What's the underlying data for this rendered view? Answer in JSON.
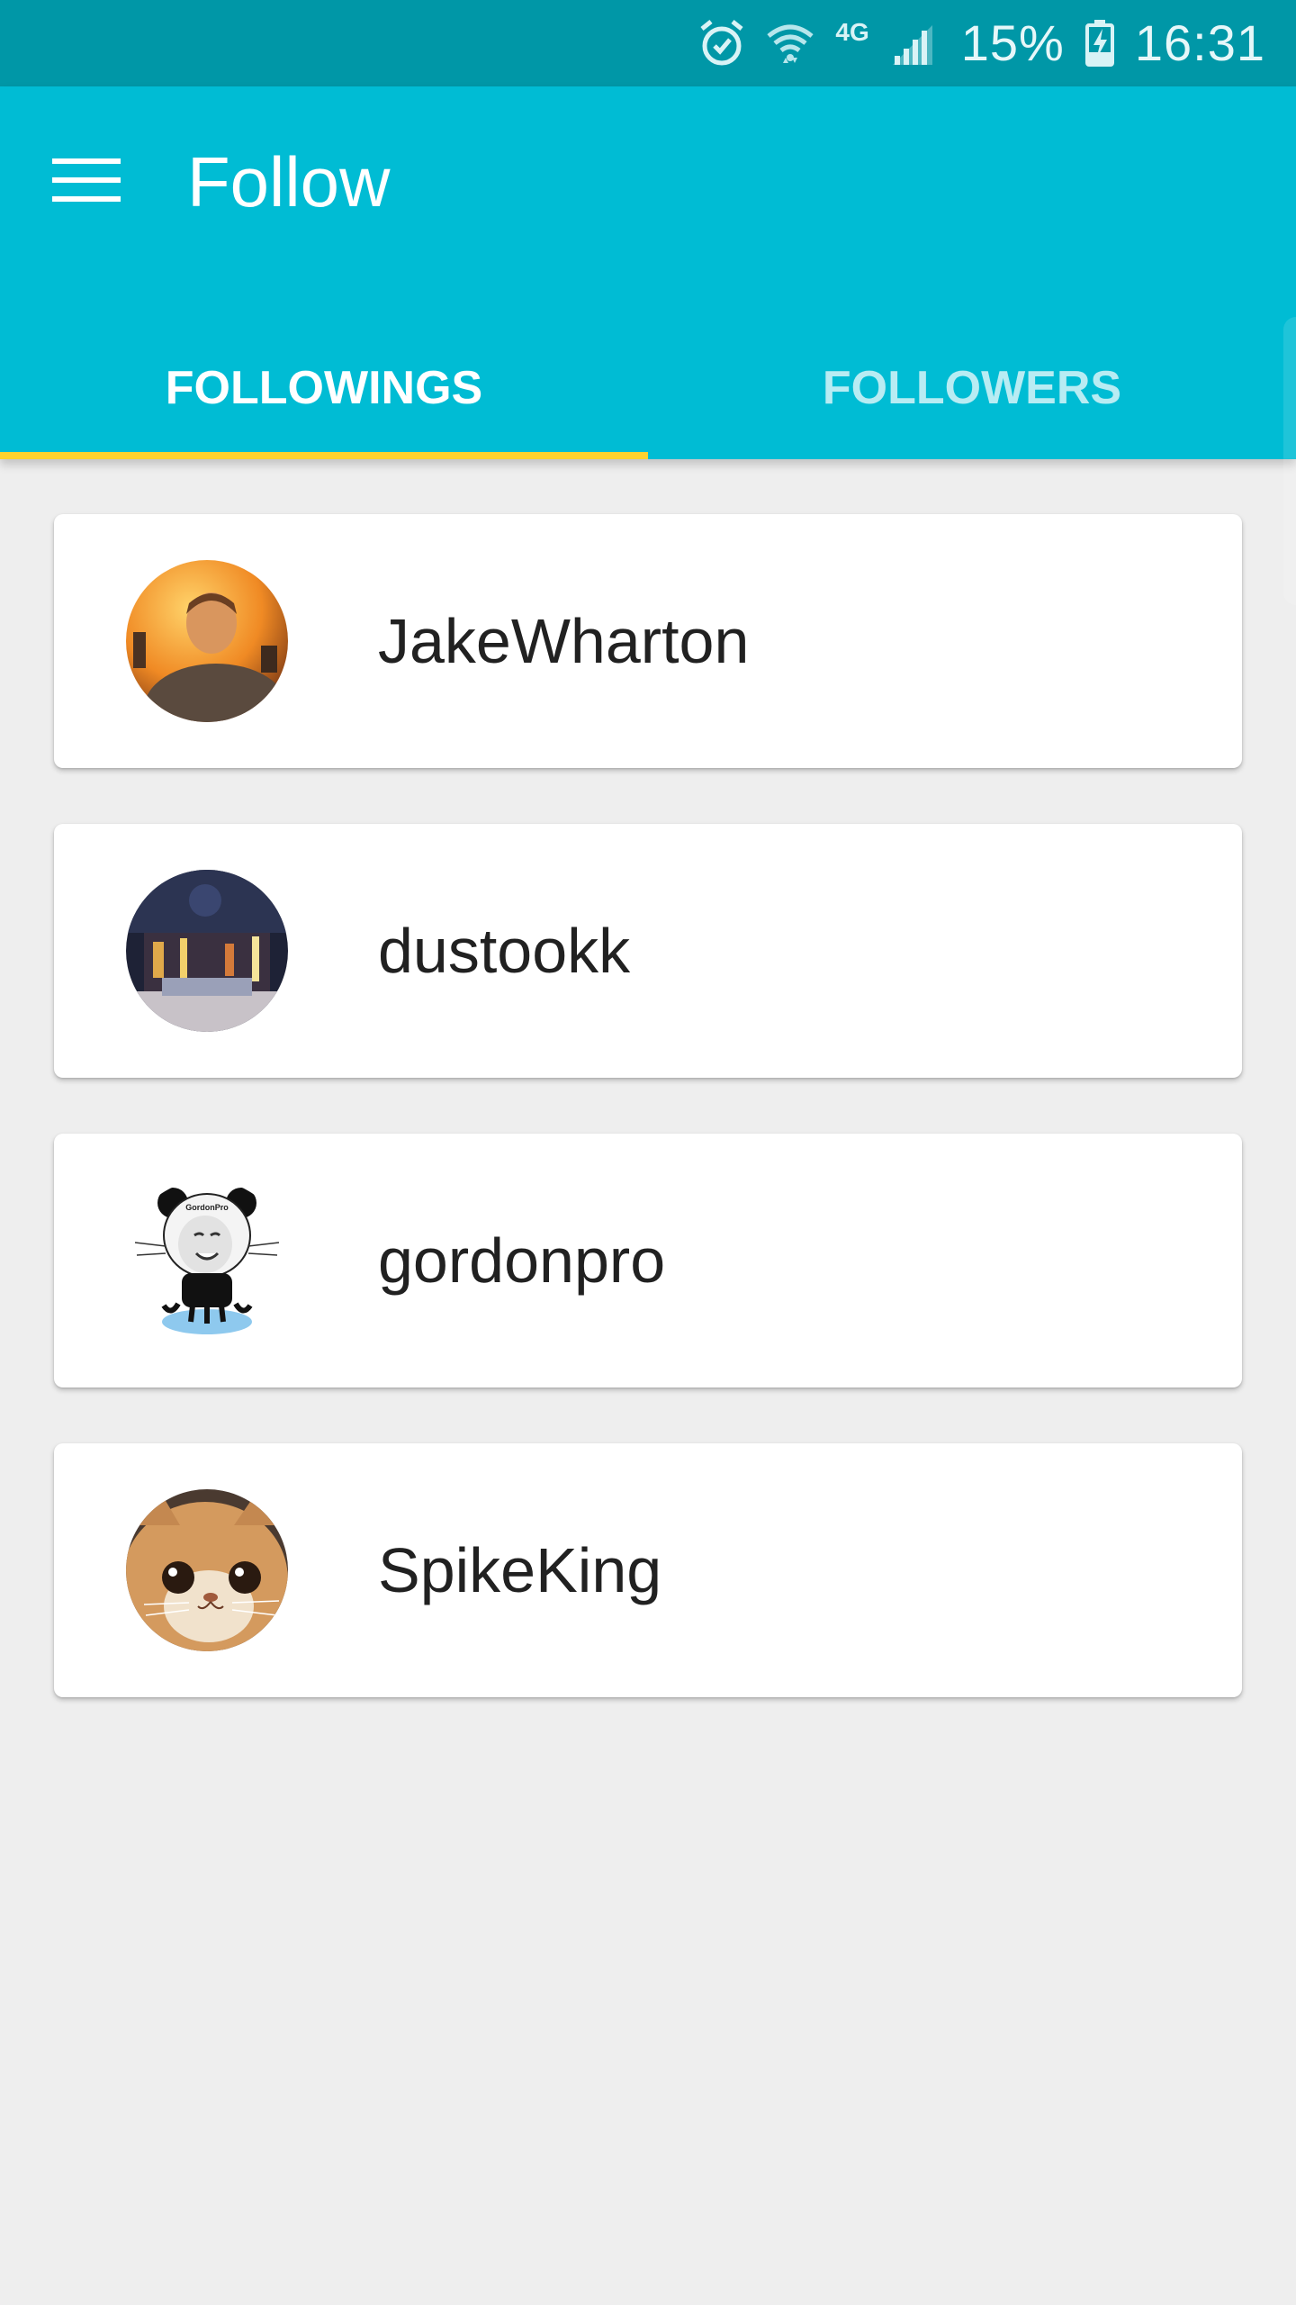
{
  "status_bar": {
    "icons": [
      "alarm-icon",
      "wifi-icon",
      "4g-icon",
      "signal-icon",
      "battery-charging-icon"
    ],
    "network_label": "4G",
    "battery_percent": "15%",
    "time": "16:31"
  },
  "app_bar": {
    "menu_icon": "hamburger-menu-icon",
    "title": "Follow"
  },
  "tabs": [
    {
      "label": "FOLLOWINGS",
      "active": true
    },
    {
      "label": "FOLLOWERS",
      "active": false
    }
  ],
  "users": [
    {
      "name": "JakeWharton"
    },
    {
      "name": "dustookk"
    },
    {
      "name": "gordonpro",
      "avatar_caption": "GordonPro"
    },
    {
      "name": "SpikeKing"
    }
  ],
  "colors": {
    "status_bar": "#0097a7",
    "primary": "#00bcd4",
    "indicator": "#ffd22e",
    "background": "#eeeeee",
    "card": "#ffffff",
    "text": "#212121"
  }
}
